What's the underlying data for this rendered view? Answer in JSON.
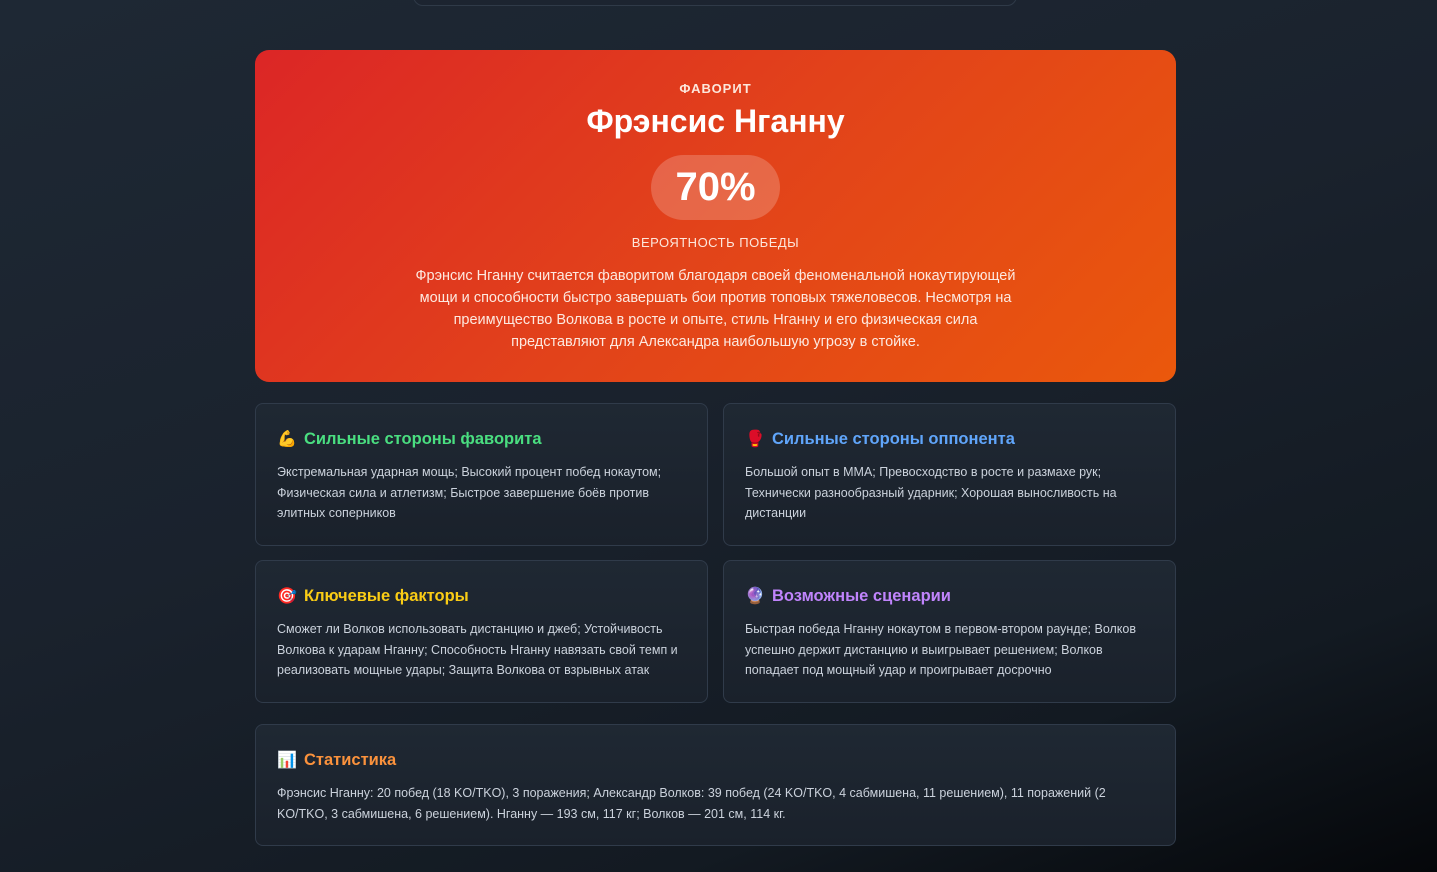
{
  "favorite": {
    "kicker": "ФАВОРИТ",
    "name": "Фрэнсис Нганну",
    "probability": "70%",
    "probability_label": "ВЕРОЯТНОСТЬ ПОБЕДЫ",
    "description": "Фрэнсис Нганну считается фаворитом благодаря своей феноменальной нокаутирующей мощи и способности быстро завершать бои против топовых тяжеловесов. Несмотря на преимущество Волкова в росте и опыте, стиль Нганну и его физическая сила представляют для Александра наибольшую угрозу в стойке.",
    "accent_colors": [
      "#dc2626",
      "#ea580c"
    ]
  },
  "cards": {
    "favorite_strengths": {
      "icon": "flexed-biceps-emoji",
      "emoji": "💪",
      "title": "Сильные стороны фаворита",
      "text": "Экстремальная ударная мощь; Высокий процент побед нокаутом; Физическая сила и атлетизм; Быстрое завершение боёв против элитных соперников",
      "color": "#4ade80"
    },
    "opponent_strengths": {
      "icon": "boxing-glove-emoji",
      "emoji": "🥊",
      "title": "Сильные стороны оппонента",
      "text": "Большой опыт в ММА; Превосходство в росте и размахе рук; Технически разнообразный ударник; Хорошая выносливость на дистанции",
      "color": "#60a5fa"
    },
    "key_factors": {
      "icon": "target-emoji",
      "emoji": "🎯",
      "title": "Ключевые факторы",
      "text": "Сможет ли Волков использовать дистанцию и джеб; Устойчивость Волкова к ударам Нганну; Способность Нганну навязать свой темп и реализовать мощные удары; Защита Волкова от взрывных атак",
      "color": "#facc15"
    },
    "scenarios": {
      "icon": "crystal-ball-emoji",
      "emoji": "🔮",
      "title": "Возможные сценарии",
      "text": "Быстрая победа Нганну нокаутом в первом-втором раунде; Волков успешно держит дистанцию и выигрывает решением; Волков попадает под мощный удар и проигрывает досрочно",
      "color": "#c084fc"
    },
    "statistics": {
      "icon": "bar-chart-emoji",
      "emoji": "📊",
      "title": "Статистика",
      "text": "Фрэнсис Нганну: 20 побед (18 KO/TKO), 3 поражения; Александр Волков: 39 побед (24 KO/TKO, 4 сабмишена, 11 решением), 11 поражений (2 KO/TKO, 3 сабмишена, 6 решением). Нганну — 193 см, 117 кг; Волков — 201 см, 114 кг.",
      "color": "#fb923c"
    }
  }
}
